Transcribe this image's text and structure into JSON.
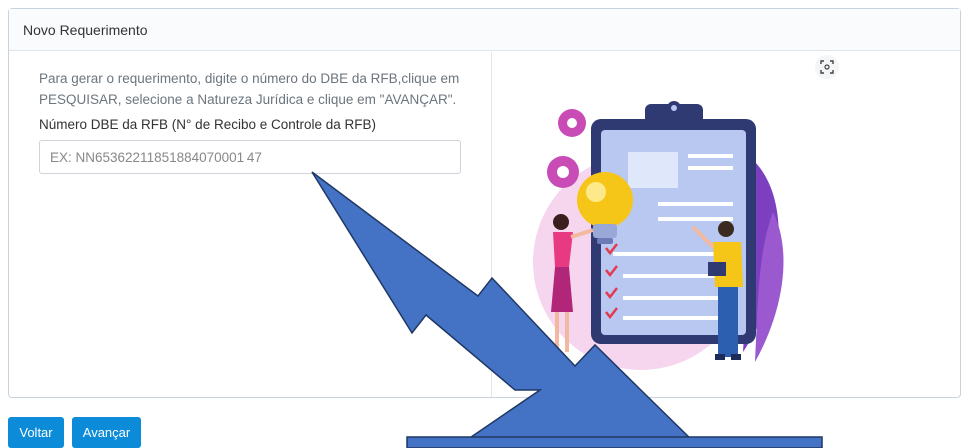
{
  "card": {
    "title": "Novo Requerimento",
    "instructions": "Para gerar o requerimento, digite o número do DBE da RFB,clique em PESQUISAR, selecione a Natureza Jurídica e clique em \"AVANÇAR\".",
    "field_label": "Número DBE da RFB (N° de Recibo e Controle da RFB)",
    "field_placeholder": "EX: NN65362211851884070001 47",
    "illustration_icon": "clipboard-lightbulb-illustration",
    "expand_icon": "expand-icon"
  },
  "buttons": {
    "back_label": "Voltar",
    "next_label": "Avançar"
  },
  "overlay": {
    "arrow_color": "#4472c4",
    "arrow_outline": "#1f3864"
  },
  "colors": {
    "primary_button": "#0b8bd8",
    "illustration_purple": "#7b3fbf",
    "illustration_pink": "#e98bd0",
    "illustration_yellow": "#f5c518"
  }
}
